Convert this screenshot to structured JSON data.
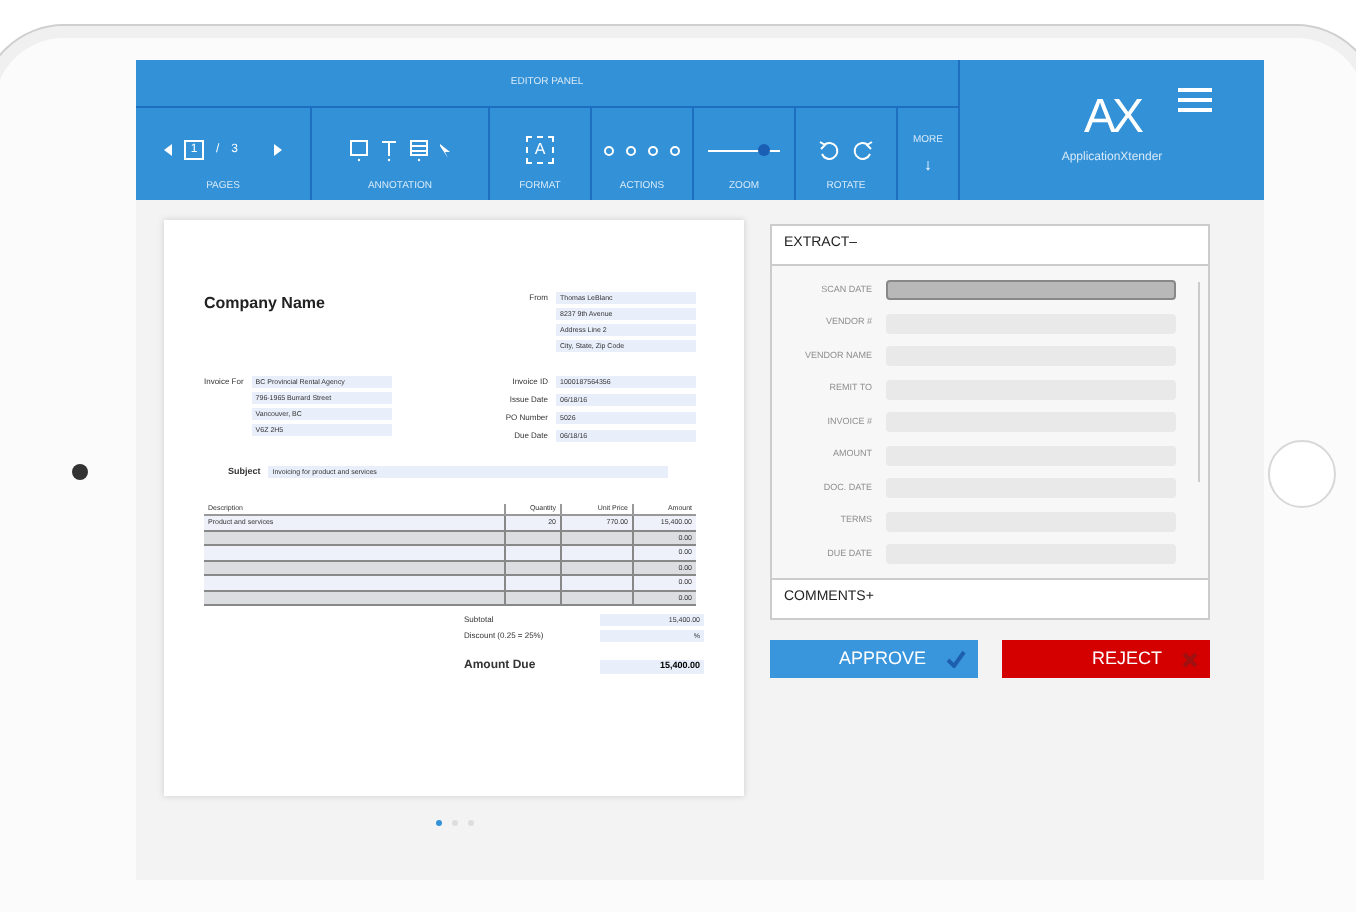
{
  "toolbar": {
    "title": "EDITOR PANEL",
    "pages": {
      "current": "1",
      "separator": "/",
      "total": "3",
      "label": "PAGES"
    },
    "annotation": {
      "label": "ANNOTATION"
    },
    "format": {
      "icon_text": "A",
      "label": "FORMAT"
    },
    "actions": {
      "label": "ACTIONS"
    },
    "zoom": {
      "level": 0.78,
      "label": "ZOOM"
    },
    "rotate": {
      "label": "ROTATE"
    },
    "more": {
      "label": "MORE",
      "arrow": "↓"
    }
  },
  "brand": {
    "logo": "AX",
    "name": "ApplicationXtender"
  },
  "document": {
    "company": "Company Name",
    "from": {
      "label": "From",
      "lines": [
        "Thomas LeBlanc",
        "8237 9th Avenue",
        "Address Line 2",
        "City, State, Zip Code"
      ]
    },
    "invoice_for": {
      "label": "Invoice For",
      "lines": [
        "BC Provincial Rental Agency",
        "796-1965 Burrard Street",
        "Vancouver, BC",
        "V6Z 2H5"
      ]
    },
    "meta": [
      {
        "label": "Invoice ID",
        "value": "1000187564356"
      },
      {
        "label": "Issue Date",
        "value": "06/18/16"
      },
      {
        "label": "PO Number",
        "value": "5026"
      },
      {
        "label": "Due Date",
        "value": "06/18/16"
      }
    ],
    "subject": {
      "label": "Subject",
      "value": "Invoicing for product and services"
    },
    "columns": [
      "Description",
      "Quantity",
      "Unit Price",
      "Amount"
    ],
    "rows": [
      [
        "Product and services",
        "20",
        "770.00",
        "15,400.00"
      ],
      [
        "",
        "",
        "",
        "0.00"
      ],
      [
        "",
        "",
        "",
        "0.00"
      ],
      [
        "",
        "",
        "",
        "0.00"
      ],
      [
        "",
        "",
        "",
        "0.00"
      ],
      [
        "",
        "",
        "",
        "0.00"
      ]
    ],
    "subtotal": {
      "label": "Subtotal",
      "value": "15,400.00"
    },
    "discount": {
      "label": "Discount (0.25 = 25%)",
      "value": "%"
    },
    "amount_due": {
      "label": "Amount Due",
      "value": "15,400.00"
    }
  },
  "page_dots": [
    {
      "selected": true
    },
    {
      "selected": false
    },
    {
      "selected": false
    }
  ],
  "extract": {
    "label": "EXTRACT–",
    "expanded": true,
    "fields": [
      {
        "label": "SCAN DATE",
        "selected": true
      },
      {
        "label": "VENDOR #",
        "selected": false
      },
      {
        "label": "VENDOR NAME",
        "selected": false
      },
      {
        "label": "REMIT TO",
        "selected": false
      },
      {
        "label": "INVOICE #",
        "selected": false
      },
      {
        "label": "AMOUNT",
        "selected": false
      },
      {
        "label": "DOC. DATE",
        "selected": false
      },
      {
        "label": "TERMS",
        "selected": false
      },
      {
        "label": "DUE DATE",
        "selected": false
      }
    ]
  },
  "comments": {
    "label": "COMMENTS+",
    "expanded": false
  },
  "buttons": [
    {
      "label": "APPROVE",
      "kind": "approve"
    },
    {
      "label": "REJECT",
      "kind": "reject"
    }
  ]
}
